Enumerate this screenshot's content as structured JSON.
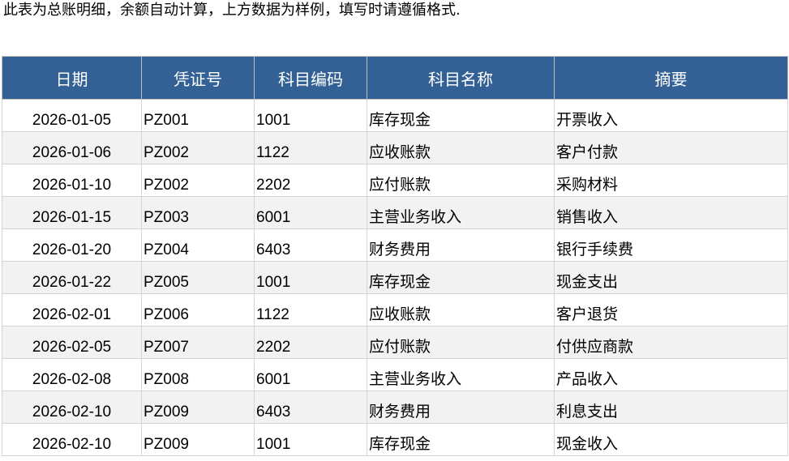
{
  "instruction": "此表为总账明细，余额自动计算，上方数据为样例，填写时请遵循格式.",
  "colors": {
    "header_bg": "#336195",
    "header_text": "#ffffff",
    "stripe": "#f2f2f2"
  },
  "table": {
    "headers": [
      "日期",
      "凭证号",
      "科目编码",
      "科目名称",
      "摘要"
    ],
    "rows": [
      [
        "2026-01-05",
        "PZ001",
        "1001",
        "库存现金",
        "开票收入"
      ],
      [
        "2026-01-06",
        "PZ002",
        "1122",
        "应收账款",
        "客户付款"
      ],
      [
        "2026-01-10",
        "PZ002",
        "2202",
        "应付账款",
        "采购材料"
      ],
      [
        "2026-01-15",
        "PZ003",
        "6001",
        "主营业务收入",
        "销售收入"
      ],
      [
        "2026-01-20",
        "PZ004",
        "6403",
        "财务费用",
        "银行手续费"
      ],
      [
        "2026-01-22",
        "PZ005",
        "1001",
        "库存现金",
        "现金支出"
      ],
      [
        "2026-02-01",
        "PZ006",
        "1122",
        "应收账款",
        "客户退货"
      ],
      [
        "2026-02-05",
        "PZ007",
        "2202",
        "应付账款",
        "付供应商款"
      ],
      [
        "2026-02-08",
        "PZ008",
        "6001",
        "主营业务收入",
        "产品收入"
      ],
      [
        "2026-02-10",
        "PZ009",
        "6403",
        "财务费用",
        "利息支出"
      ],
      [
        "2026-02-10",
        "PZ009",
        "1001",
        "库存现金",
        "现金收入"
      ]
    ]
  }
}
